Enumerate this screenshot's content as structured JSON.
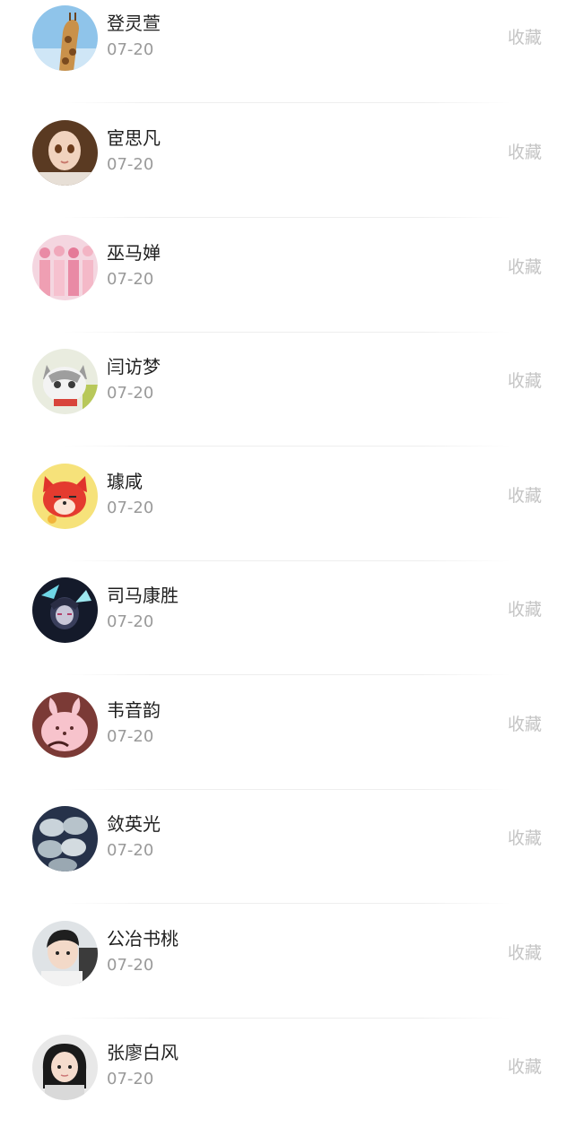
{
  "items": [
    {
      "name": "登灵萱",
      "date": "07-20",
      "action": "收藏",
      "avatar": "giraffe-avatar"
    },
    {
      "name": "宦思凡",
      "date": "07-20",
      "action": "收藏",
      "avatar": "doll-avatar"
    },
    {
      "name": "巫马婵",
      "date": "07-20",
      "action": "收藏",
      "avatar": "group-photo-avatar"
    },
    {
      "name": "闫访梦",
      "date": "07-20",
      "action": "收藏",
      "avatar": "cat-avatar"
    },
    {
      "name": "璩咸",
      "date": "07-20",
      "action": "收藏",
      "avatar": "red-fox-cartoon-avatar"
    },
    {
      "name": "司马康胜",
      "date": "07-20",
      "action": "收藏",
      "avatar": "anime-character-avatar"
    },
    {
      "name": "韦音韵",
      "date": "07-20",
      "action": "收藏",
      "avatar": "pink-bunny-avatar"
    },
    {
      "name": "敛英光",
      "date": "07-20",
      "action": "收藏",
      "avatar": "stones-avatar"
    },
    {
      "name": "公冶书桃",
      "date": "07-20",
      "action": "收藏",
      "avatar": "boy-avatar"
    },
    {
      "name": "张廖白风",
      "date": "07-20",
      "action": "收藏",
      "avatar": "girl-avatar"
    }
  ]
}
